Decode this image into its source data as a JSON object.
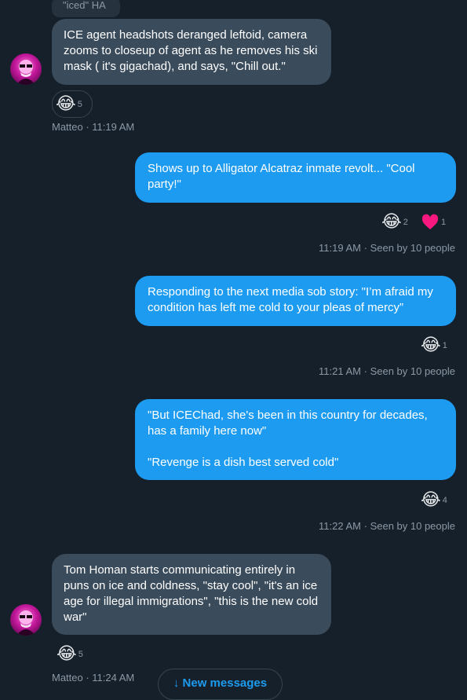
{
  "conversation": {
    "quoted_snippet": "\"iced\" HA",
    "messages": [
      {
        "direction": "incoming",
        "text": "ICE agent headshots deranged leftoid, camera zooms to closeup of agent as he removes his ski mask ( it's gigachad), and says, \"Chill out.\"",
        "reactions": [
          {
            "emoji": "😂",
            "count": "5"
          }
        ],
        "meta": "Matteo · 11:19 AM"
      },
      {
        "direction": "outgoing",
        "text": "Shows up to Alligator Alcatraz inmate revolt... \"Cool party!\"",
        "reactions": [
          {
            "emoji": "😂",
            "count": "2"
          },
          {
            "emoji": "❤",
            "count": "1"
          }
        ],
        "time": "11:19 AM",
        "seen": "Seen by 10 people"
      },
      {
        "direction": "outgoing",
        "text": "Responding to the next media sob story: \"I’m afraid my condition has left me cold to your pleas of mercy”",
        "reactions": [
          {
            "emoji": "😂",
            "count": "1"
          }
        ],
        "time": "11:21 AM",
        "seen": "Seen by 10 people"
      },
      {
        "direction": "outgoing",
        "text_line1": "\"But ICEChad, she's been in this country for decades, has a family here now\"",
        "text_line2": "\"Revenge is a dish best served cold\"",
        "reactions": [
          {
            "emoji": "😂",
            "count": "4"
          }
        ],
        "time": "11:22 AM",
        "seen": "Seen by 10 people"
      },
      {
        "direction": "incoming",
        "text": "Tom Homan starts communicating entirely in puns on ice and coldness, \"stay cool\", \"it's an ice age for illegal immigrations\", \"this is the new cold war\"",
        "reactions": [
          {
            "emoji": "😂",
            "count": "5"
          }
        ],
        "meta": "Matteo · 11:24 AM"
      }
    ],
    "separator": "·",
    "new_messages_label": "↓ New messages"
  },
  "colors": {
    "background": "#15202b",
    "incoming_bubble": "#3a4b5c",
    "outgoing_bubble": "#1d9bf0",
    "accent": "#1d9bf0",
    "heart": "#f91880"
  }
}
